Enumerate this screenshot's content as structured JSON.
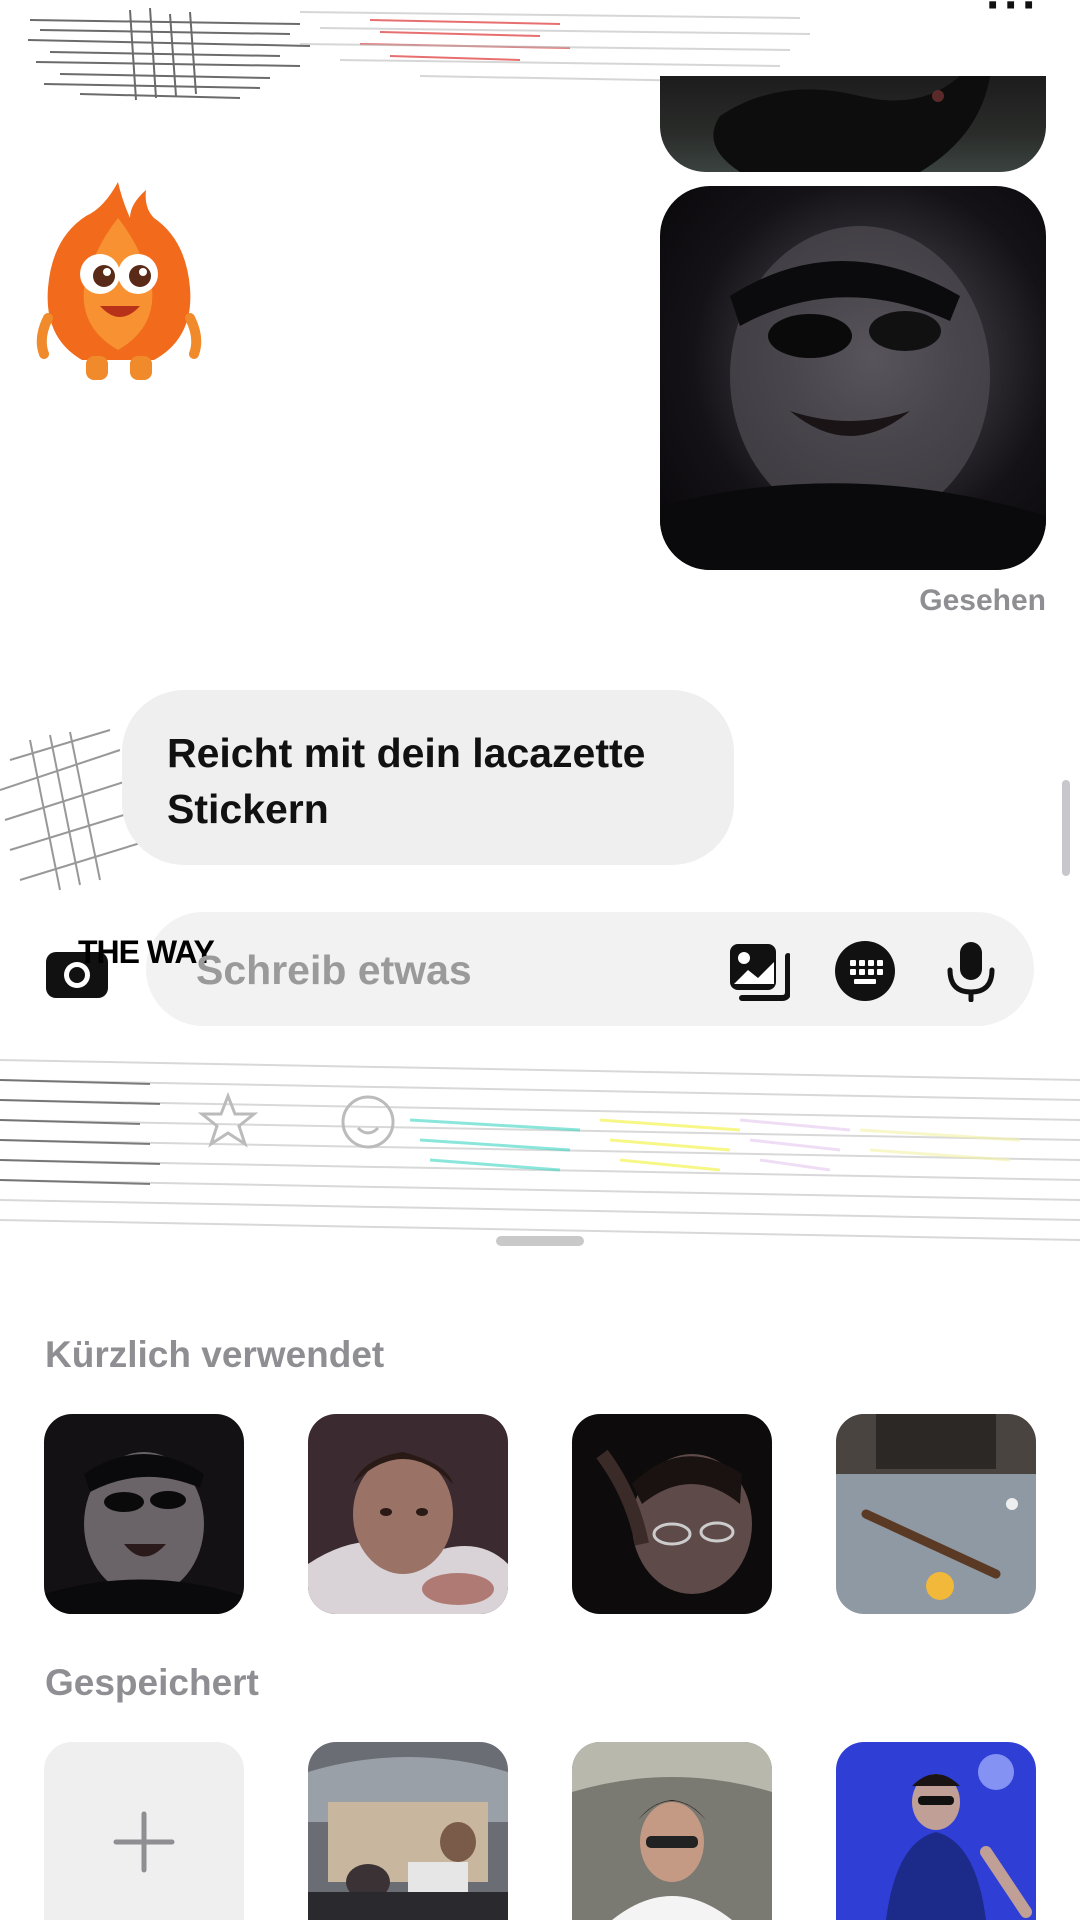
{
  "header": {
    "more_icon": "more-horizontal-icon"
  },
  "messages": {
    "seen_label": "Gesehen",
    "received_text": "Reicht mit dein lacazette Stickern"
  },
  "composer": {
    "placeholder": "Schreib etwas",
    "camera_label": "THE WAY",
    "icons": [
      "photo-library-icon",
      "keyboard-icon",
      "microphone-icon"
    ]
  },
  "sticker_tray": {
    "categories": [
      "star-icon",
      "smiley-icon"
    ],
    "recent_title": "Kürzlich verwendet",
    "saved_title": "Gespeichert",
    "add_icon": "plus-icon"
  },
  "colors": {
    "bubble": "#efefef",
    "secondary_text": "#8e8e93",
    "accent_sticker": "#f26a1b"
  }
}
